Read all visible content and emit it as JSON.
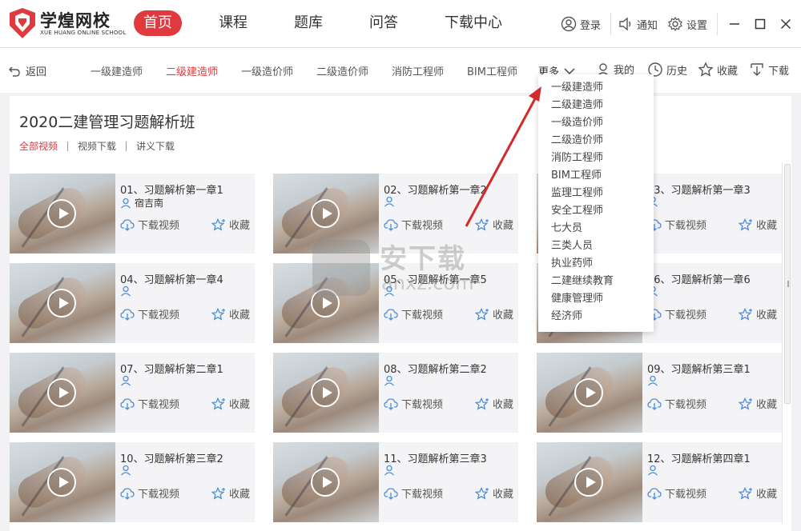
{
  "brand": {
    "name": "学煌网校",
    "subtitle": "XUE HUANG ONLINE SCHOOL",
    "color": "#e03a3e"
  },
  "main_nav": [
    {
      "label": "首页",
      "active": true
    },
    {
      "label": "课程",
      "active": false
    },
    {
      "label": "题库",
      "active": false
    },
    {
      "label": "问答",
      "active": false
    },
    {
      "label": "下载中心",
      "active": false
    }
  ],
  "top_right": {
    "login": "登录",
    "notice": "通知",
    "settings": "设置"
  },
  "sub_nav": {
    "back": "返回",
    "categories": [
      {
        "label": "一级建造师",
        "active": false
      },
      {
        "label": "二级建造师",
        "active": true
      },
      {
        "label": "一级造价师",
        "active": false
      },
      {
        "label": "二级造价师",
        "active": false
      },
      {
        "label": "消防工程师",
        "active": false
      },
      {
        "label": "BIM工程师",
        "active": false
      }
    ],
    "more": "更多",
    "mine": "我的",
    "history": "历史",
    "favorites": "收藏",
    "download": "下载"
  },
  "dropdown": [
    "一级建造师",
    "二级建造师",
    "一级造价师",
    "二级造价师",
    "消防工程师",
    "BIM工程师",
    "监理工程师",
    "安全工程师",
    "七大员",
    "三类人员",
    "执业药师",
    "二建继续教育",
    "健康管理师",
    "经济师"
  ],
  "page": {
    "title": "2020二建管理习题解析班",
    "filters": [
      {
        "label": "全部视频",
        "active": true
      },
      {
        "label": "视频下载",
        "active": false
      },
      {
        "label": "讲义下载",
        "active": false
      }
    ]
  },
  "card_actions": {
    "download": "下载视频",
    "favorite": "收藏"
  },
  "videos": [
    {
      "title": "01、习题解析第一章1",
      "teacher": "宿吉南"
    },
    {
      "title": "02、习题解析第一章2",
      "teacher": ""
    },
    {
      "title": "03、习题解析第一章3",
      "teacher": ""
    },
    {
      "title": "04、习题解析第一章4",
      "teacher": ""
    },
    {
      "title": "05、习题解析第一章5",
      "teacher": ""
    },
    {
      "title": "06、习题解析第一章6",
      "teacher": ""
    },
    {
      "title": "07、习题解析第二章1",
      "teacher": ""
    },
    {
      "title": "08、习题解析第二章2",
      "teacher": ""
    },
    {
      "title": "09、习题解析第三章1",
      "teacher": ""
    },
    {
      "title": "10、习题解析第三章2",
      "teacher": ""
    },
    {
      "title": "11、习题解析第三章3",
      "teacher": ""
    },
    {
      "title": "12、习题解析第四章1",
      "teacher": ""
    }
  ],
  "watermark": {
    "text": "安下载",
    "sub": "anxz.com"
  }
}
